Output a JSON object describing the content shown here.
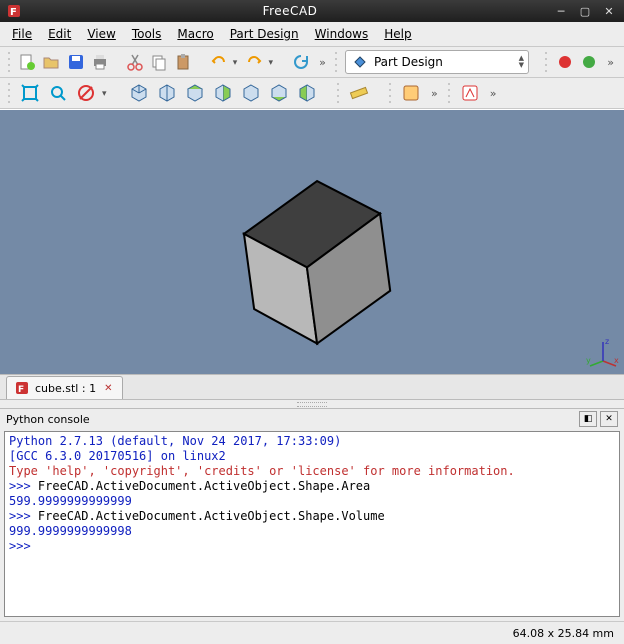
{
  "title": "FreeCAD",
  "menu": [
    "File",
    "Edit",
    "View",
    "Tools",
    "Macro",
    "Part Design",
    "Windows",
    "Help"
  ],
  "workbench_selected": "Part Design",
  "tab": {
    "label": "cube.stl : 1"
  },
  "panel_title": "Python console",
  "console": {
    "banner1": "Python 2.7.13 (default, Nov 24 2017, 17:33:09)",
    "banner2": "[GCC 6.3.0 20170516] on linux2",
    "banner3": "Type 'help', 'copyright', 'credits' or 'license' for more information.",
    "prompt": ">>> ",
    "cmd1": "FreeCAD.ActiveDocument.ActiveObject.Shape.Area",
    "out1": "599.9999999999999",
    "cmd2": "FreeCAD.ActiveDocument.ActiveObject.Shape.Volume",
    "out2": "999.9999999999998"
  },
  "status": "64.08 x 25.84 mm",
  "colors": {
    "viewport_bg": "#748aa6"
  }
}
